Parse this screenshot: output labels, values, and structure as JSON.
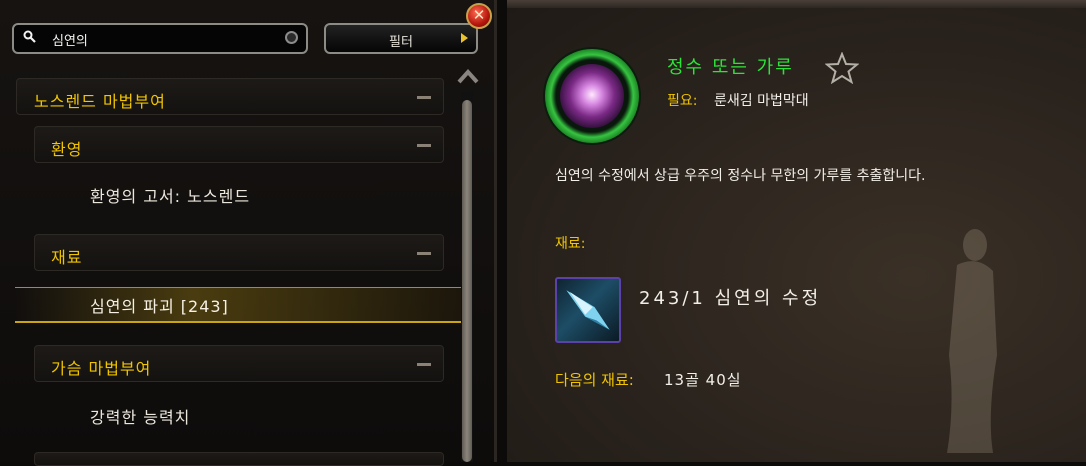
{
  "search": {
    "value": "심연의"
  },
  "filter": {
    "label": "필터"
  },
  "close": {
    "label": "✕"
  },
  "tree": {
    "category": {
      "label": "노스렌드 마법부여"
    },
    "groups": [
      {
        "label": "환영",
        "items": [
          "환영의 고서: 노스렌드"
        ]
      },
      {
        "label": "재료",
        "items": [
          "심연의 파괴 [243]"
        ]
      },
      {
        "label": "가슴 마법부여",
        "items": [
          "강력한 능력치"
        ]
      }
    ]
  },
  "detail": {
    "title": "정수 또는 가루",
    "requires_label": "필요:",
    "requires_value": "룬새김 마법막대",
    "description": "심연의 수정에서 상급 우주의 정수나 무한의 가루를 추출합니다.",
    "reagents_label": "재료:",
    "reagent": {
      "count": "243/1",
      "name": "심연의 수정"
    },
    "cost_label": "다음의 재료:",
    "cost_value": "13골 40실"
  },
  "colors": {
    "gold": "#f0c400",
    "green": "#2de33a",
    "white": "#f2efe8"
  },
  "icons": {
    "search": "search-icon",
    "clear": "clear-search-icon",
    "filter_arrow": "arrow-right-icon",
    "close": "close-icon",
    "favorite": "star-icon",
    "collapse": "collapse-minus-icon",
    "recipe": "essence-recipe-icon",
    "reagent": "abyss-crystal-icon"
  }
}
